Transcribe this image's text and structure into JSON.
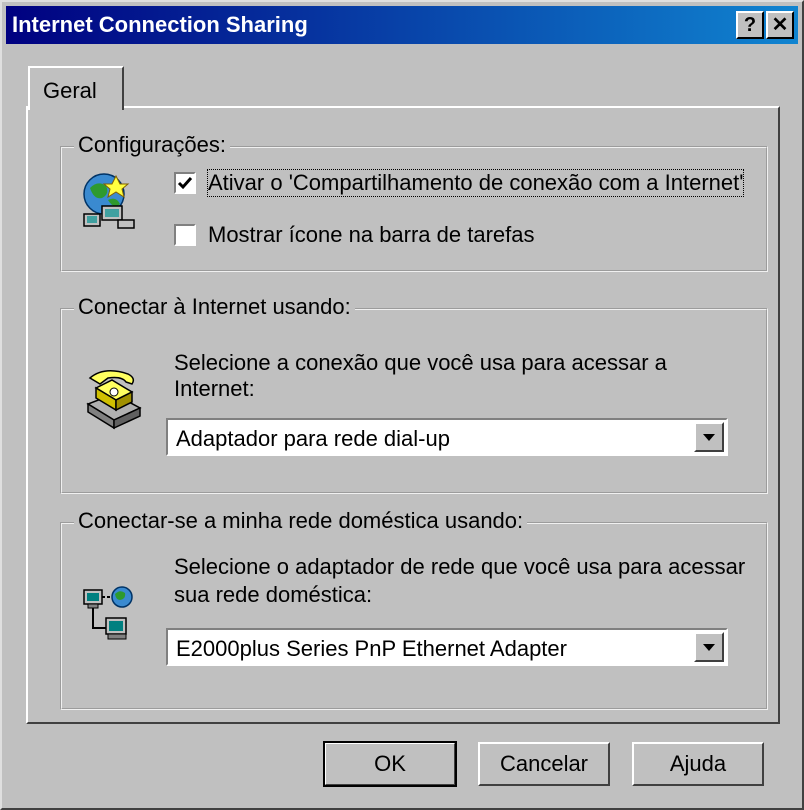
{
  "window": {
    "title": "Internet Connection Sharing",
    "help_button": "?",
    "close_button": "✕"
  },
  "tabs": [
    {
      "label": "Geral",
      "selected": true
    }
  ],
  "configuracoes": {
    "legend": "Configurações:",
    "icon": "network-globe-icon",
    "enable_sharing": {
      "label": "Ativar o 'Compartilhamento de conexão com a Internet'",
      "checked": true
    },
    "show_icon": {
      "label": "Mostrar ícone na barra de tarefas",
      "checked": false
    }
  },
  "connect_internet": {
    "legend": "Conectar à Internet usando:",
    "icon": "telephone-icon",
    "description_line1": "Selecione a conexão que você usa para acessar a",
    "description_line2": "Internet:",
    "selected": "Adaptador para rede dial-up"
  },
  "home_network": {
    "legend": "Conectar-se a minha rede doméstica usando:",
    "icon": "home-network-icon",
    "description_line1": "Selecione o adaptador de rede que você usa para acessar",
    "description_line2": "sua rede doméstica:",
    "selected": "E2000plus Series PnP Ethernet Adapter"
  },
  "buttons": {
    "ok": "OK",
    "cancel": "Cancelar",
    "help": "Ajuda"
  }
}
